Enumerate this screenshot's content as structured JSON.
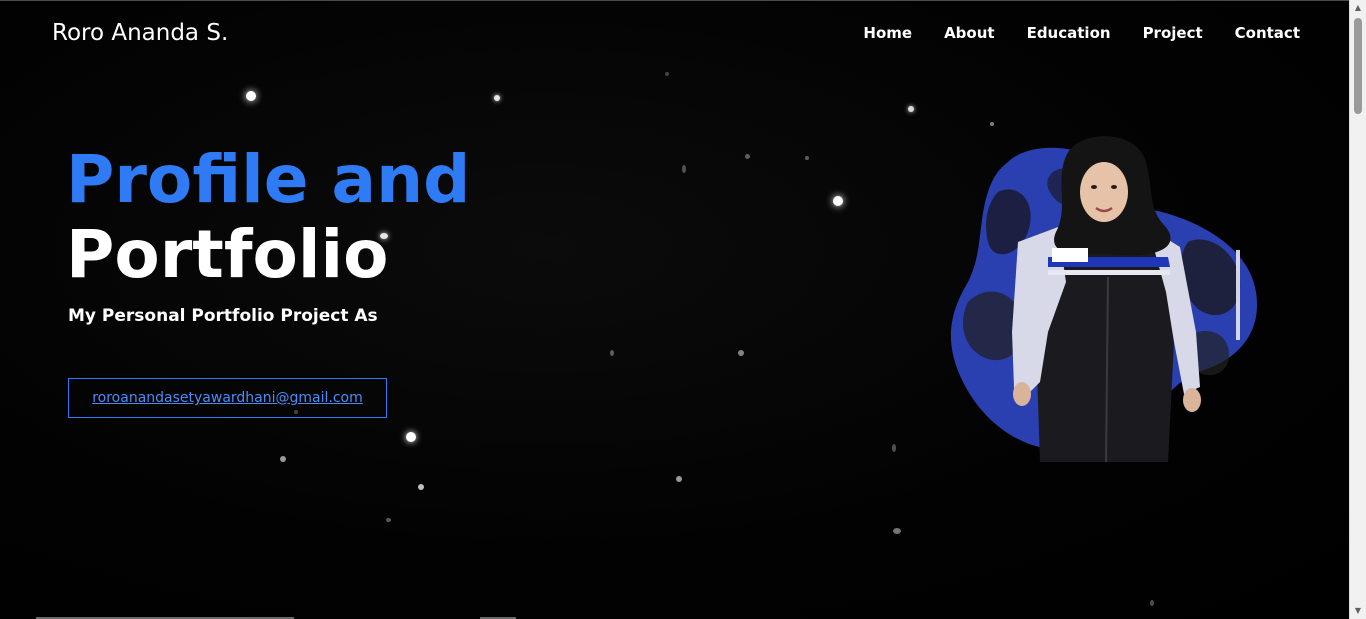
{
  "header": {
    "brand": "Roro Ananda S.",
    "nav": [
      "Home",
      "About",
      "Education",
      "Project",
      "Contact"
    ]
  },
  "hero": {
    "title_line1": "Profile and",
    "title_line2": "Portfolio",
    "subtitle": "My Personal Portfolio Project As",
    "email": "roroanandasetyawardhani@gmail.com"
  },
  "colors": {
    "accent": "#2f7bf5",
    "background": "#000000",
    "text": "#ffffff"
  },
  "icons": {
    "scroll_up": "chevron-up-icon",
    "scroll_down": "chevron-down-icon"
  }
}
